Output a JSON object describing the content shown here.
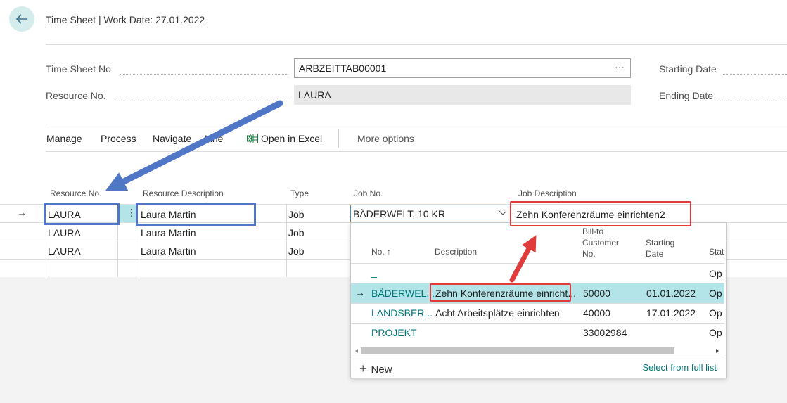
{
  "header": {
    "title": "Time Sheet | Work Date: 27.01.2022"
  },
  "fields": {
    "time_sheet_no_label": "Time Sheet No",
    "time_sheet_no_value": "ARBZEITTAB00001",
    "time_sheet_no_ellipsis": "···",
    "resource_no_label": "Resource No.",
    "resource_no_value": "LAURA",
    "starting_date_label": "Starting Date",
    "ending_date_label": "Ending Date"
  },
  "menu": {
    "manage": "Manage",
    "process": "Process",
    "navigate": "Navigate",
    "line": "Line",
    "open_in_excel": "Open in Excel",
    "more_options": "More options"
  },
  "lines": {
    "headers": {
      "resource_no": "Resource No.",
      "resource_description": "Resource Description",
      "type": "Type",
      "job_no": "Job No.",
      "job_description": "Job Description"
    },
    "rows": [
      {
        "resource_no": "LAURA",
        "resource_description": "Laura Martin",
        "type": "Job",
        "job_no": "BÄDERWELT, 10 KR",
        "job_description": "Zehn Konferenzräume einrichten2"
      },
      {
        "resource_no": "LAURA",
        "resource_description": "Laura Martin",
        "type": "Job"
      },
      {
        "resource_no": "LAURA",
        "resource_description": "Laura Martin",
        "type": "Job"
      }
    ]
  },
  "dropdown": {
    "headers": {
      "no": "No. ↑",
      "description": "Description",
      "bill_to_1": "Bill-to",
      "bill_to_2": "Customer",
      "bill_to_3": "No.",
      "starting_1": "Starting",
      "starting_2": "Date",
      "status": "Stat"
    },
    "rows": [
      {
        "no": "_",
        "description": "",
        "customer": "",
        "date": "",
        "status": "Op"
      },
      {
        "no": "BÄDERWEL...",
        "description": "Zehn Konferenzräume einricht...",
        "customer": "50000",
        "date": "01.01.2022",
        "status": "Op"
      },
      {
        "no": "LANDSBER...",
        "description": "Acht Arbeitsplätze einrichten",
        "customer": "40000",
        "date": "17.01.2022",
        "status": "Op"
      },
      {
        "no": "PROJEKT",
        "description": "",
        "customer": "33002984",
        "date": "",
        "status": "Op"
      }
    ],
    "new_label": "New",
    "select_full_list": "Select from full list"
  },
  "colors": {
    "accent": "#00757a",
    "selected_row": "#b3e5e8",
    "annotation_red": "#e03c3c",
    "annotation_blue": "#4f77c6"
  }
}
